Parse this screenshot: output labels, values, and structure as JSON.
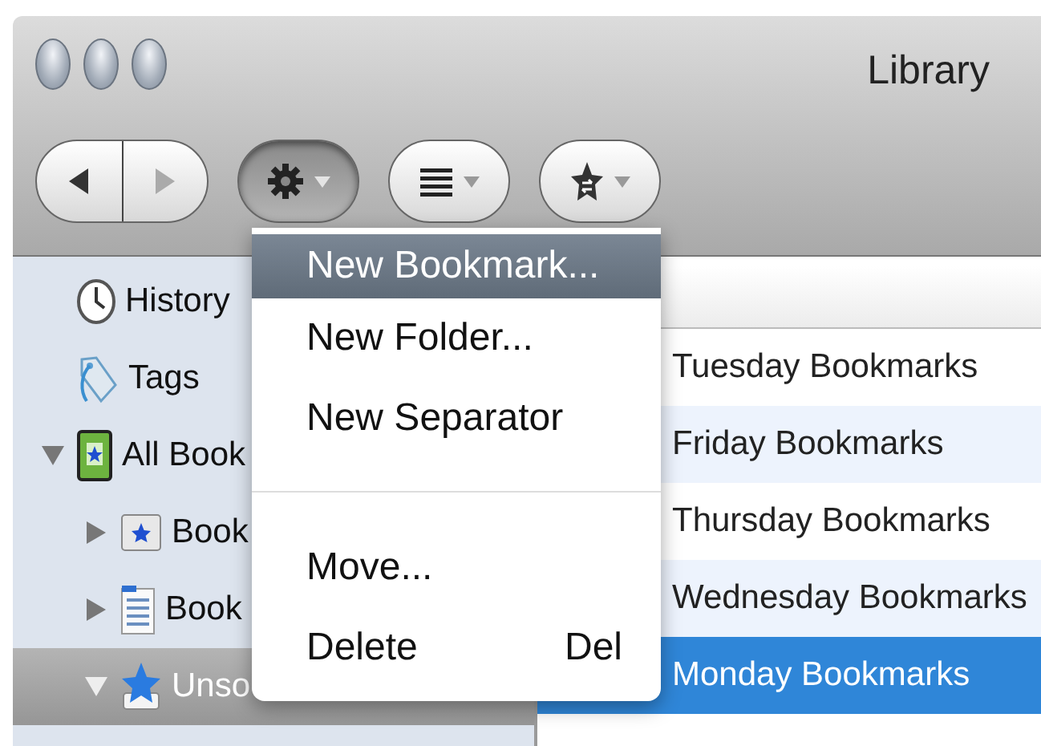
{
  "window": {
    "title": "Library"
  },
  "navigation": {
    "back_disabled": false,
    "forward_disabled": true
  },
  "toolbar": [
    {
      "kind": "organize",
      "pressed": true
    },
    {
      "kind": "views",
      "pressed": false
    },
    {
      "kind": "import",
      "pressed": false
    }
  ],
  "sidebar": {
    "items": [
      {
        "kind": "history",
        "label": "History",
        "selected": false
      },
      {
        "kind": "tags",
        "label": "Tags",
        "selected": false
      },
      {
        "kind": "all",
        "label": "All Book",
        "selected": false,
        "expanded": true,
        "children": [
          {
            "kind": "toolbar",
            "label": "Book",
            "selected": false,
            "expanded": false
          },
          {
            "kind": "menu",
            "label": "Book",
            "selected": false,
            "expanded": false
          },
          {
            "kind": "unsorted",
            "label": "Unso",
            "selected": true,
            "expanded": true
          }
        ]
      }
    ]
  },
  "list": {
    "rows": [
      {
        "label": "Tuesday Bookmarks",
        "selected": false
      },
      {
        "label": "Friday Bookmarks",
        "selected": false
      },
      {
        "label": "Thursday Bookmarks",
        "selected": false
      },
      {
        "label": "Wednesday Bookmarks",
        "selected": false
      },
      {
        "label": "Monday Bookmarks",
        "selected": true
      }
    ]
  },
  "menu": {
    "items": [
      {
        "kind": "item",
        "label": "New Bookmark...",
        "selected": true
      },
      {
        "kind": "item",
        "label": "New Folder...",
        "selected": false
      },
      {
        "kind": "item",
        "label": "New Separator",
        "selected": false
      },
      {
        "kind": "separator"
      },
      {
        "kind": "item",
        "label": "Move...",
        "selected": false
      },
      {
        "kind": "item",
        "label": "Delete",
        "shortcut": "Del",
        "selected": false
      }
    ]
  }
}
